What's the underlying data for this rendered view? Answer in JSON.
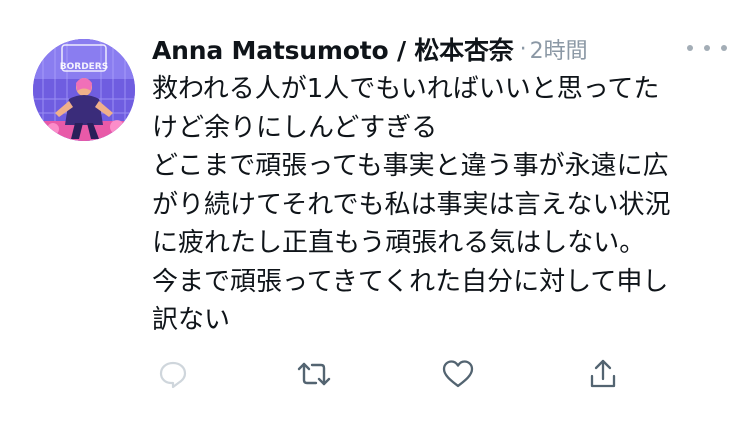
{
  "tweet": {
    "author_name": "Anna Matsumoto / 松本杏奈",
    "separator": "·",
    "timestamp": "2時間",
    "avatar_banner_text": "BORDERS",
    "body_lines": [
      "救われる人が1人でもいればいいと思ってた",
      "けど余りにしんどすぎる",
      "どこまで頑張っても事実と違う事が永遠に広",
      "がり続けてそれでも私は事実は言えない状況",
      "に疲れたし正直もう頑張れる気はしない。",
      "今まで頑張ってきてくれた自分に対して申し",
      "訳ない"
    ]
  },
  "actions": [
    {
      "icon": "reply-icon"
    },
    {
      "icon": "retweet-icon"
    },
    {
      "icon": "like-icon"
    },
    {
      "icon": "share-icon"
    }
  ],
  "colors": {
    "text": "#0f1419",
    "muted": "#8b98a5",
    "icon": "#536471",
    "reply_icon": "#cfd6dc"
  }
}
